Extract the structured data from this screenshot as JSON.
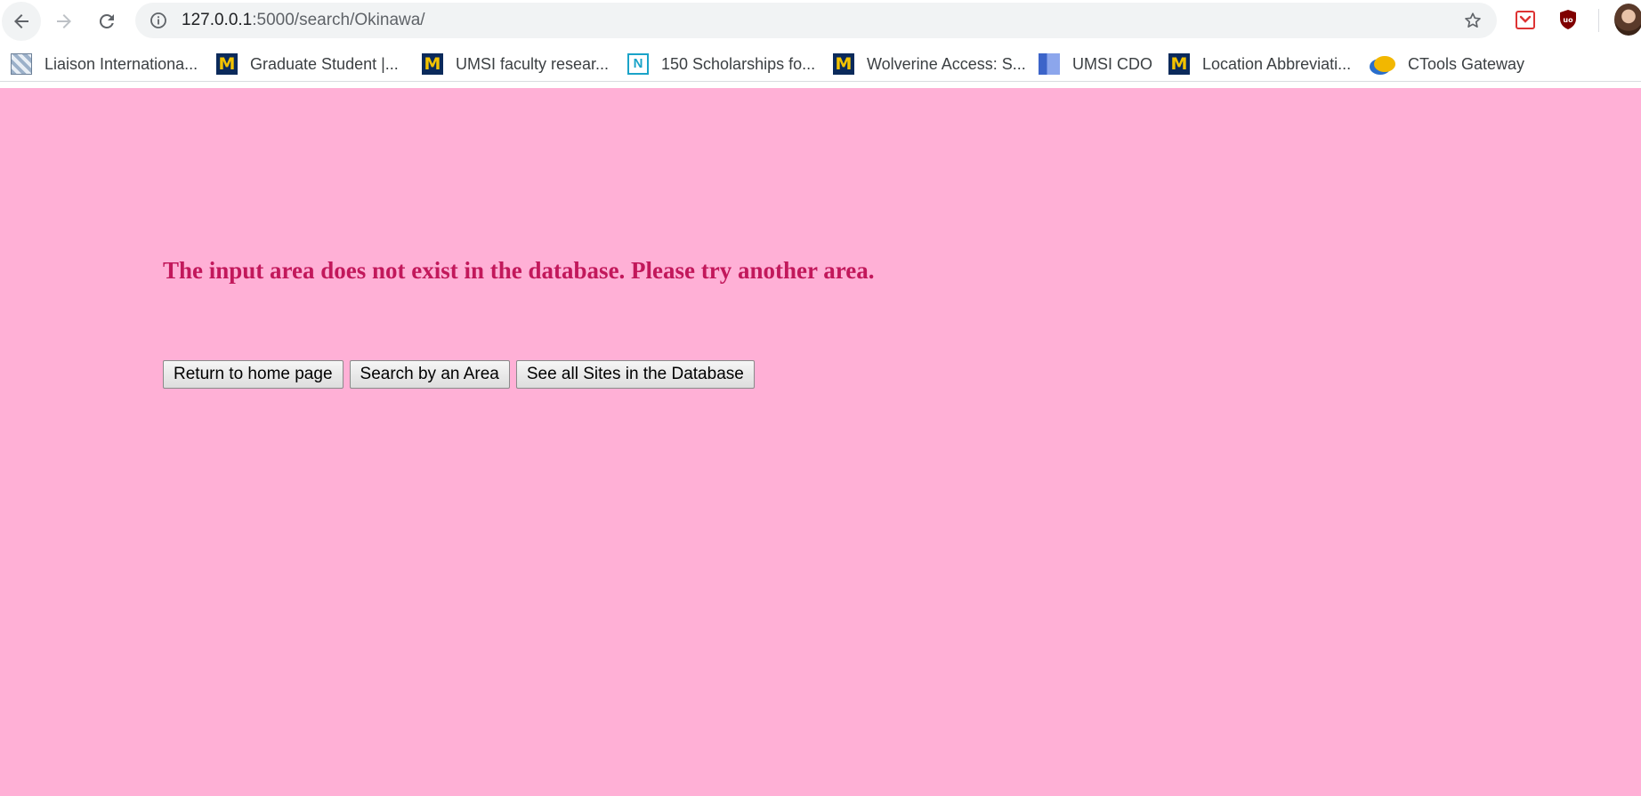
{
  "browser": {
    "url_host": "127.0.0.1",
    "url_path": ":5000/search/Okinawa/",
    "icons": {
      "back": "arrow-left-icon",
      "forward": "arrow-right-icon",
      "reload": "reload-icon",
      "info": "info-icon",
      "bookmark": "star-icon"
    }
  },
  "bookmarks": [
    {
      "label": "Liaison Internationa...",
      "icon": "liaison-favicon"
    },
    {
      "label": "Graduate Student |...",
      "icon": "umich-m-favicon"
    },
    {
      "label": "UMSI faculty resear...",
      "icon": "umich-m-favicon"
    },
    {
      "label": "150 Scholarships fo...",
      "icon": "n-favicon"
    },
    {
      "label": "Wolverine Access: S...",
      "icon": "umich-m-favicon"
    },
    {
      "label": "UMSI CDO",
      "icon": "document-favicon"
    },
    {
      "label": "Location Abbreviati...",
      "icon": "umich-m-favicon"
    },
    {
      "label": "CTools Gateway",
      "icon": "ctools-favicon"
    }
  ],
  "page": {
    "background": "#ffb0d6",
    "heading_color": "#c2185b",
    "error_message": "The input area does not exist in the database. Please try another area.",
    "buttons": {
      "home": "Return to home page",
      "search_area": "Search by an Area",
      "all_sites": "See all Sites in the Database"
    }
  }
}
